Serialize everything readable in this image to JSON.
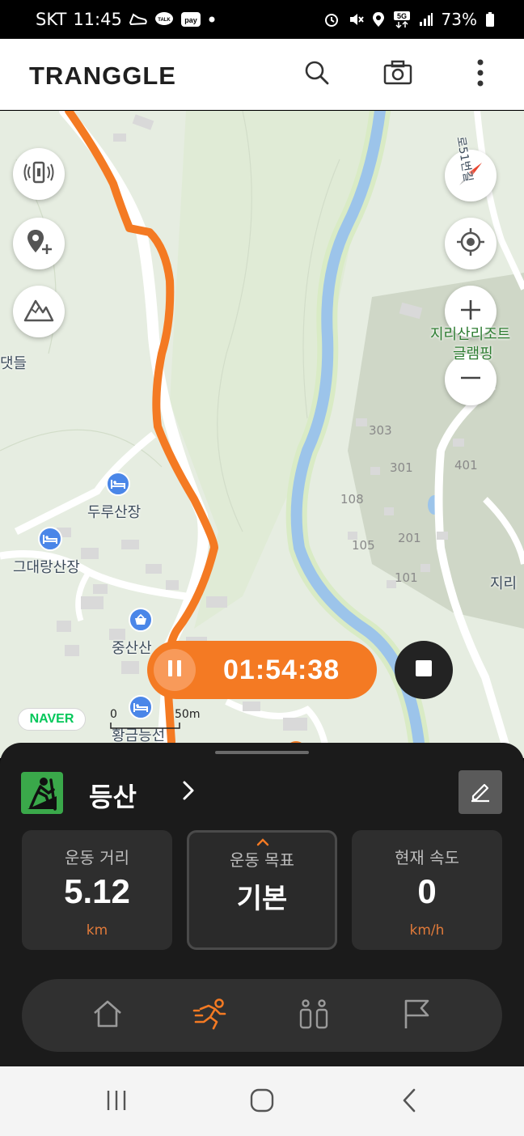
{
  "status_bar": {
    "carrier": "SKT",
    "time": "11:45",
    "battery": "73%",
    "network": "5G",
    "icons": [
      "shoe-icon",
      "kakaotalk-icon",
      "payco-icon",
      "dot-icon",
      "alarm-icon",
      "mute-icon",
      "location-icon",
      "5g-icon",
      "signal-icon",
      "battery-icon"
    ]
  },
  "header": {
    "logo": "TRANGGLE",
    "buttons": [
      "search-icon",
      "camera-icon",
      "more-icon"
    ]
  },
  "map": {
    "labels": {
      "left_edge": "댓들",
      "duru": "두루산장",
      "geudaerang": "그대랑산장",
      "jungsan": "중산산",
      "hwanggeum": "황금능선",
      "resort_1": "지리산리조트",
      "resort_2": "글램핑",
      "jiri_right": "지리",
      "road_51": "로51번길"
    },
    "numbers": [
      "303",
      "301",
      "401",
      "108",
      "201",
      "105",
      "101"
    ],
    "left_buttons": [
      "nearby-signal-icon",
      "add-location-icon",
      "mountain-icon"
    ],
    "right_buttons": [
      "compass-icon",
      "my-location-icon",
      "zoom-in-icon",
      "zoom-out-icon"
    ],
    "provider": "NAVER",
    "scale_zero": "0",
    "scale_value": "50m",
    "colors": {
      "route": "#f47a23",
      "river": "#9cc4ea",
      "road": "#ffffff",
      "land": "#e6ede1"
    }
  },
  "recording": {
    "elapsed": "01:54:38",
    "pause_icon": "pause-icon",
    "stop_icon": "stop-icon",
    "accent": "#f47a23"
  },
  "panel": {
    "activity": "등산",
    "activity_icon": "hiker-icon",
    "edit_icon": "pencil-icon",
    "stats": [
      {
        "label": "운동 거리",
        "value": "5.12",
        "unit": "km"
      },
      {
        "label": "운동 목표",
        "value": "기본",
        "unit": ""
      },
      {
        "label": "현재 속도",
        "value": "0",
        "unit": "km/h"
      }
    ],
    "nav": [
      {
        "name": "home-icon",
        "active": false
      },
      {
        "name": "running-icon",
        "active": true
      },
      {
        "name": "group-icon",
        "active": false
      },
      {
        "name": "flag-icon",
        "active": false
      }
    ]
  },
  "system_nav": [
    "recents-icon",
    "home-circle-icon",
    "back-icon"
  ]
}
